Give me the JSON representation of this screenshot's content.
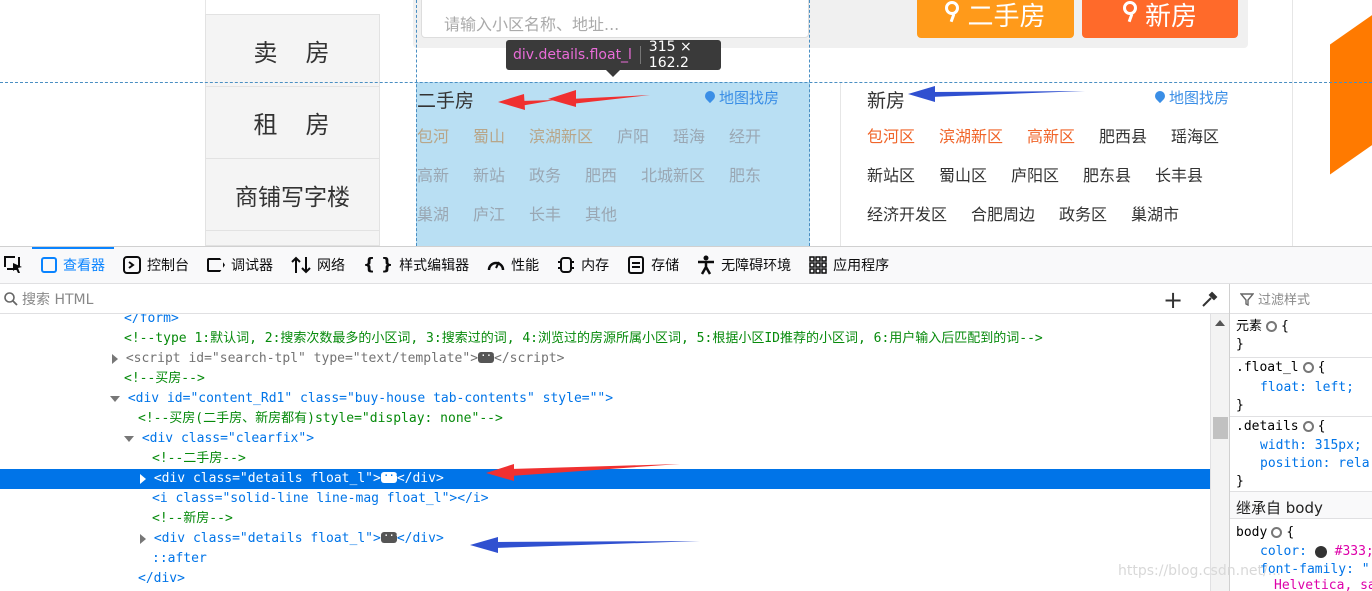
{
  "page": {
    "left_nav": [
      "卖　房",
      "租　房",
      "商铺写字楼"
    ],
    "search": {
      "placeholder": "请输入小区名称、地址..."
    },
    "buttons": {
      "second_hand": "二手房",
      "new_house": "新房"
    },
    "tooltip": {
      "tag": "div",
      "classes": ".details.float_l",
      "size": "315 × 162.2"
    },
    "second_hand": {
      "title": "二手房",
      "map_link": "地图找房",
      "rows": [
        [
          "包河",
          "蜀山",
          "滨湖新区",
          "庐阳",
          "瑶海",
          "经开"
        ],
        [
          "高新",
          "新站",
          "政务",
          "肥西",
          "北城新区",
          "肥东"
        ],
        [
          "巢湖",
          "庐江",
          "长丰",
          "其他"
        ]
      ]
    },
    "new_house": {
      "title": "新房",
      "map_link": "地图找房",
      "rows": [
        [
          "包河区",
          "滨湖新区",
          "高新区",
          "肥西县",
          "瑶海区"
        ],
        [
          "新站区",
          "蜀山区",
          "庐阳区",
          "肥东县",
          "长丰县"
        ],
        [
          "经济开发区",
          "合肥周边",
          "政务区",
          "巢湖市"
        ]
      ]
    }
  },
  "devtools": {
    "tabs": [
      "查看器",
      "控制台",
      "调试器",
      "网络",
      "样式编辑器",
      "性能",
      "内存",
      "存储",
      "无障碍环境",
      "应用程序"
    ],
    "search_placeholder": "搜索 HTML",
    "filter_placeholder": "过滤样式",
    "markup": [
      "</form>",
      "<!--type 1:默认词, 2:搜索次数最多的小区词, 3:搜索过的词, 4:浏览过的房源所属小区词, 5:根据小区ID推荐的小区词, 6:用户输入后匹配到的词-->",
      "<script id=\"search-tpl\" type=\"text/template\">",
      "<!--买房-->",
      "<div id=\"content_Rd1\" class=\"buy-house tab-contents\" style=\"\">",
      "<!--买房(二手房、新房都有)style=\"display: none\"-->",
      "<div class=\"clearfix\">",
      "<!--二手房-->",
      "<div class=\"details float_l\">",
      "<i class=\"solid-line line-mag float_l\"></i>",
      "<!--新房-->",
      "<div class=\"details float_l\">",
      "::after",
      "</div>"
    ],
    "rules": {
      "element_label": "元素",
      "float_selector": ".float_l",
      "float_prop": "float: left;",
      "details_selector": ".details",
      "details_width": "width: 315px;",
      "details_position": "position: rela",
      "inherited": "继承自 body",
      "body_selector": "body",
      "body_color": "color:",
      "body_color_value": "#333;",
      "body_font": "font-family: \"",
      "body_font_more": "Helvetica, sa"
    },
    "watermark": "https://blog.csdn.net/..."
  }
}
